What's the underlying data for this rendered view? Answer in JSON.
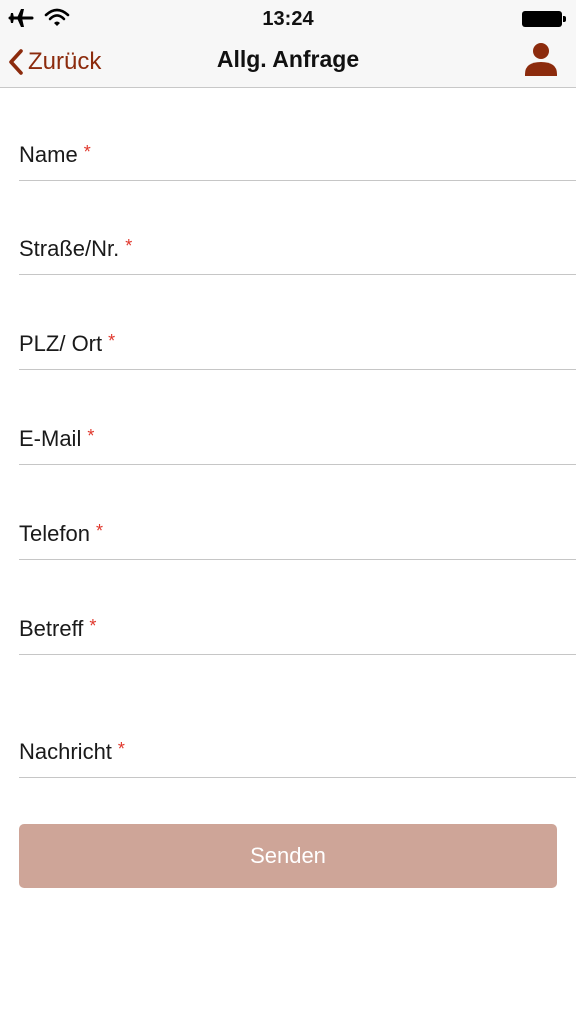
{
  "status_bar": {
    "time": "13:24",
    "icons": [
      "airplane-icon",
      "wifi-icon",
      "battery-icon"
    ]
  },
  "nav": {
    "back_label": "Zurück",
    "title": "Allg. Anfrage",
    "profile_icon": "person-icon"
  },
  "form": {
    "required_marker": "*",
    "fields": [
      {
        "label": "Name"
      },
      {
        "label": "Straße/Nr."
      },
      {
        "label": "PLZ/ Ort"
      },
      {
        "label": "E-Mail"
      },
      {
        "label": "Telefon"
      },
      {
        "label": "Betreff"
      },
      {
        "label": "Nachricht"
      }
    ],
    "submit_label": "Senden"
  },
  "colors": {
    "accent": "#8c2b0d",
    "button_background": "#cea598",
    "required_marker": "#e0362b"
  }
}
